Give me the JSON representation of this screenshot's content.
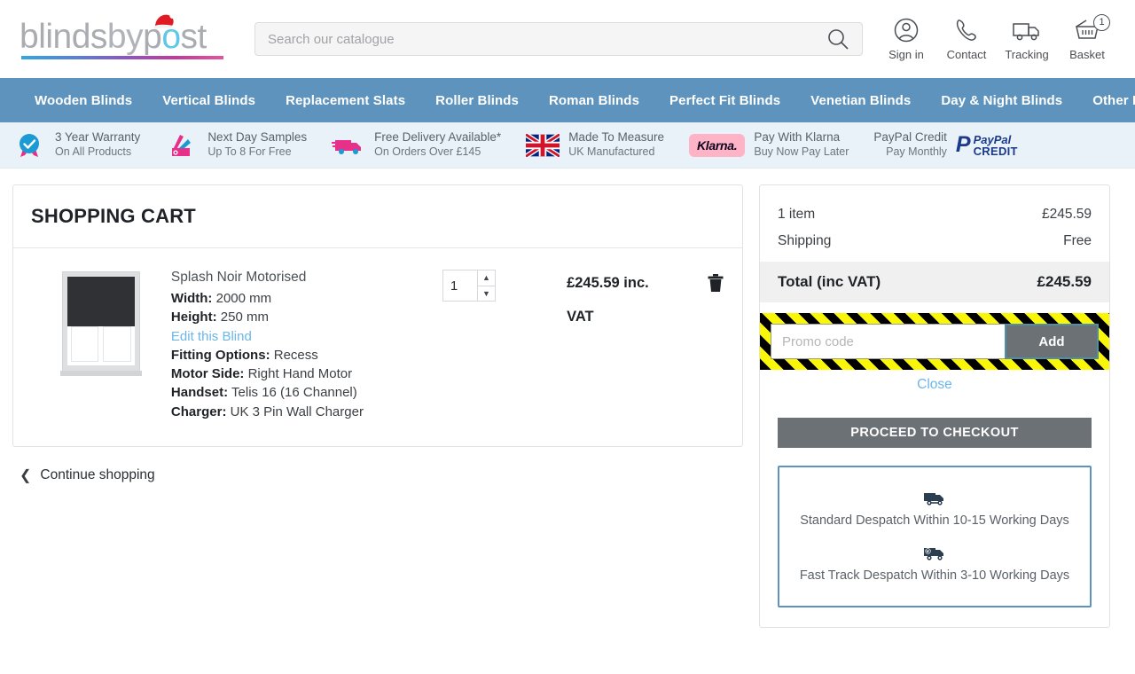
{
  "header": {
    "logo": {
      "part1": "blinds",
      "part2": "by",
      "part3": "p",
      "part4": "st",
      "alt": "blindsbypost"
    },
    "search": {
      "placeholder": "Search our catalogue",
      "value": ""
    },
    "actions": [
      {
        "label": "Sign in",
        "icon": "user-icon"
      },
      {
        "label": "Contact",
        "icon": "phone-icon"
      },
      {
        "label": "Tracking",
        "icon": "truck-icon"
      },
      {
        "label": "Basket",
        "icon": "basket-icon",
        "badge": "1"
      }
    ]
  },
  "nav": {
    "items": [
      {
        "label": "Wooden Blinds"
      },
      {
        "label": "Vertical Blinds"
      },
      {
        "label": "Replacement Slats"
      },
      {
        "label": "Roller Blinds"
      },
      {
        "label": "Roman Blinds"
      },
      {
        "label": "Perfect Fit Blinds"
      },
      {
        "label": "Venetian Blinds"
      },
      {
        "label": "Day & Night Blinds"
      },
      {
        "label": "Other Blinds"
      }
    ]
  },
  "usp": {
    "items": [
      {
        "icon": "rosette-check-icon",
        "line1": "3 Year Warranty",
        "line2": "On All Products"
      },
      {
        "icon": "samples-fan-icon",
        "line1": "Next Day Samples",
        "line2": "Up To 8 For Free"
      },
      {
        "icon": "delivery-van-icon",
        "line1": "Free Delivery Available*",
        "line2": "On Orders Over £145"
      },
      {
        "icon": "union-jack-icon",
        "line1": "Made To Measure",
        "line2": "UK Manufactured"
      },
      {
        "icon": "klarna-logo",
        "badge_text": "Klarna.",
        "line1": "Pay With Klarna",
        "line2": "Buy Now Pay Later"
      },
      {
        "icon": "paypal-credit-logo",
        "line1": "PayPal Credit",
        "line2": "Pay Monthly",
        "logo_word1": "PayPal",
        "logo_word2": "CREDIT"
      }
    ]
  },
  "cart": {
    "title": "SHOPPING CART",
    "item": {
      "thumbnail_alt": "roller-blind-thumbnail",
      "name": "Splash Noir Motorised",
      "specs": [
        {
          "label": "Width:",
          "value": "2000 mm"
        },
        {
          "label": "Height:",
          "value": "250 mm"
        }
      ],
      "edit_link": "Edit this Blind",
      "specs2": [
        {
          "label": "Fitting Options:",
          "value": "Recess"
        },
        {
          "label": "Motor Side:",
          "value": "Right Hand Motor"
        },
        {
          "label": "Handset:",
          "value": "Telis 16 (16 Channel)"
        },
        {
          "label": "Charger:",
          "value": "UK 3 Pin Wall Charger"
        }
      ],
      "quantity": "1",
      "price_line1": "£245.59 inc.",
      "price_line2": "VAT",
      "remove_icon": "trash-icon"
    },
    "continue_shopping": "Continue shopping"
  },
  "summary": {
    "rows": [
      {
        "label": "1 item",
        "value": "£245.59"
      },
      {
        "label": "Shipping",
        "value": "Free"
      }
    ],
    "total_label": "Total (inc VAT)",
    "total_value": "£245.59",
    "promo": {
      "placeholder": "Promo code",
      "value": "",
      "add_label": "Add",
      "close_label": "Close"
    },
    "checkout_label": "PROCEED TO CHECKOUT",
    "despatch": [
      {
        "icon": "van-icon",
        "text": "Standard Despatch Within 10-15 Working Days"
      },
      {
        "icon": "fast-van-icon",
        "text": "Fast Track Despatch Within 3-10 Working Days"
      }
    ]
  },
  "colors": {
    "nav_blue": "#5d93bd",
    "usp_bg": "#e9f2f9",
    "link_blue": "#6cb6e8",
    "button_grey": "#6b7175",
    "hazard_yellow": "#f9f60a",
    "hazard_black": "#000000",
    "accent_teal": "#4e90a8",
    "klarna_pink": "#ffb3c7"
  }
}
